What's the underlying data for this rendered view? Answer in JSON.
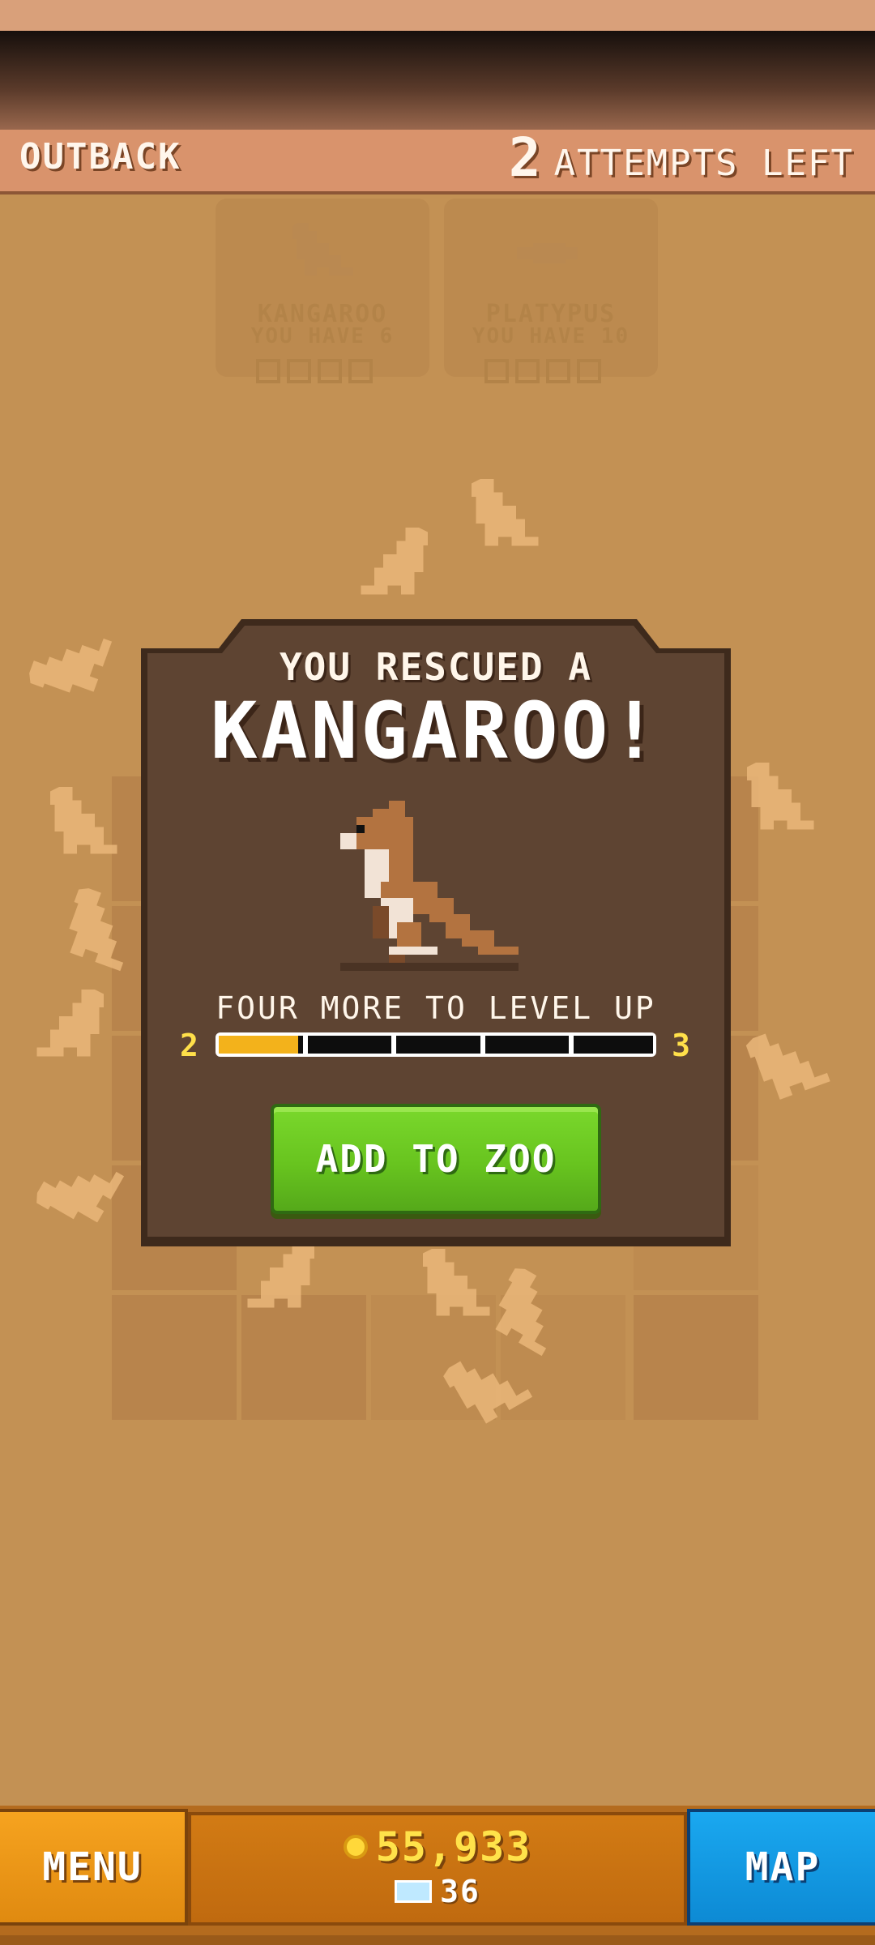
{
  "header": {
    "location": "OUTBACK",
    "attempts_count": "2",
    "attempts_label": "ATTEMPTS LEFT"
  },
  "background_cards": [
    {
      "name": "KANGAROO",
      "have": "YOU HAVE 6"
    },
    {
      "name": "PLATYPUS",
      "have": "YOU HAVE 10"
    }
  ],
  "modal": {
    "line1": "YOU RESCUED A",
    "line2": "KANGAROO!",
    "level_text": "FOUR MORE TO LEVEL UP",
    "level_from": "2",
    "level_to": "3",
    "progress": {
      "filled_segments": 1,
      "total_segments": 5
    },
    "add_button": "ADD TO ZOO",
    "icon": "kangaroo-pixel-art"
  },
  "bottom_bar": {
    "menu_label": "MENU",
    "coins": "55,933",
    "gems": "36",
    "map_label": "MAP"
  },
  "colors": {
    "background": "#c39154",
    "modal": "#5e4432",
    "add_button": "#6ccb22",
    "menu_button": "#f0991a",
    "map_button": "#1aa0e6",
    "progress_fill": "#f3b21b"
  }
}
